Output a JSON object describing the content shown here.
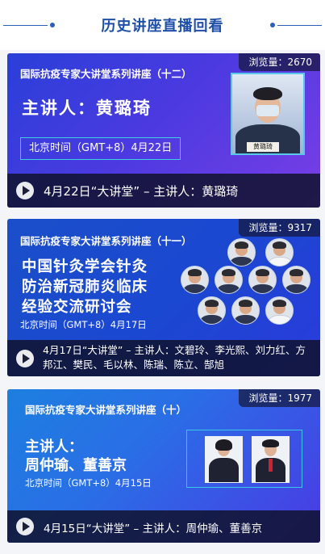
{
  "header": {
    "title": "历史讲座直播回看"
  },
  "cards": [
    {
      "views": "浏览量：2670",
      "series": "国际抗疫专家大讲堂系列讲座（十二）",
      "speaker": "主讲人：黄璐琦",
      "time": "北京时间（GMT+8）4月22日",
      "nameplate": "黄璐琦",
      "caption": "4月22日“大讲堂” – 主讲人：黄璐琦"
    },
    {
      "views": "浏览量：9317",
      "series": "国际抗疫专家大讲堂系列讲座（十一）",
      "headline_1": "中国针灸学会针灸",
      "headline_2": "防治新冠肺炎临床",
      "headline_3": "经验交流研讨会",
      "time": "北京时间（GMT+8）4月17日",
      "caption": "4月17日“大讲堂” – 主讲人：文碧玲、李光熙、刘力红、方邦江、樊民、毛以林、陈瑞、陈立、郜旭"
    },
    {
      "views": "浏览量：1977",
      "series": "国际抗疫专家大讲堂系列讲座（十）",
      "speaker_1": "主讲人：",
      "speaker_2": "周仲瑜、董善京",
      "time": "北京时间（GMT+8）4月15日",
      "caption": "4月15日“大讲堂” – 主讲人：周仲瑜、董善京"
    }
  ]
}
